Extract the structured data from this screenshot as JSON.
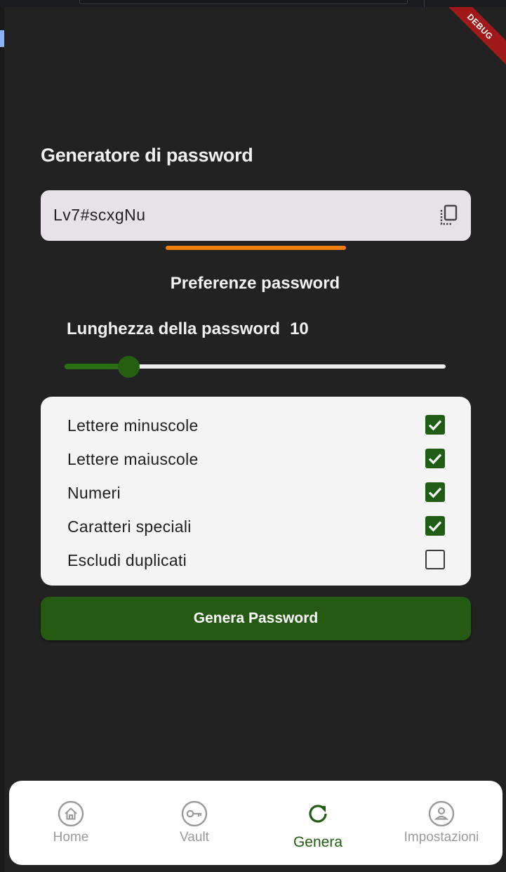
{
  "debug_banner": "DEBUG",
  "page": {
    "title": "Generatore di password",
    "generated_password": "Lv7#scxgNu",
    "preferences_title": "Preferenze password",
    "length_label": "Lunghezza della password",
    "length_value": "10",
    "slider": {
      "min": 4,
      "max": 50,
      "value": 10,
      "fill_fraction": 0.17
    }
  },
  "options": [
    {
      "label": "Lettere minuscole",
      "checked": true
    },
    {
      "label": "Lettere maiuscole",
      "checked": true
    },
    {
      "label": "Numeri",
      "checked": true
    },
    {
      "label": "Caratteri speciali",
      "checked": true
    },
    {
      "label": "Escludi duplicati",
      "checked": false
    }
  ],
  "generate_button": "Genera Password",
  "nav": [
    {
      "label": "Home",
      "icon": "home-icon",
      "active": false
    },
    {
      "label": "Vault",
      "icon": "key-icon",
      "active": false
    },
    {
      "label": "Genera",
      "icon": "refresh-icon",
      "active": true
    },
    {
      "label": "Impostazioni",
      "icon": "person-icon",
      "active": false
    }
  ],
  "colors": {
    "background": "#222222",
    "accent_green": "#245a11",
    "strength_orange": "#f27d0c",
    "field_bg": "#e7e1e8"
  }
}
